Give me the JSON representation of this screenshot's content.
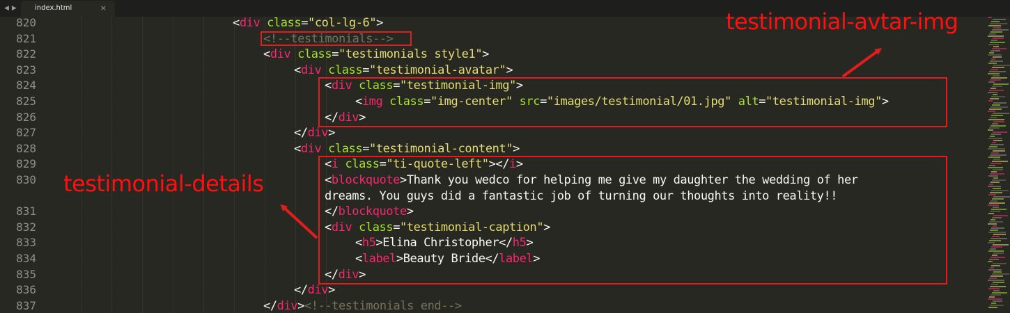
{
  "tab": {
    "title": "index.html",
    "close_glyph": "×"
  },
  "nav_arrows": [
    "◀",
    "▶"
  ],
  "line_numbers": [
    "820",
    "821",
    "822",
    "823",
    "824",
    "825",
    "826",
    "827",
    "828",
    "829",
    "830",
    "",
    "831",
    "832",
    "833",
    "834",
    "835",
    "836",
    "837"
  ],
  "code": {
    "l820": [
      "<",
      "div",
      " ",
      "class",
      "=",
      "\"col-lg-6\"",
      ">"
    ],
    "l821": "<!--testimonials-->",
    "l822": [
      "<",
      "div",
      " ",
      "class",
      "=",
      "\"testimonials style1\"",
      ">"
    ],
    "l823": [
      "<",
      "div",
      " ",
      "class",
      "=",
      "\"testimonial-avatar\"",
      ">"
    ],
    "l824": [
      "<",
      "div",
      " ",
      "class",
      "=",
      "\"testimonial-img\"",
      ">"
    ],
    "l825": [
      "<",
      "img",
      " ",
      "class",
      "=",
      "\"img-center\"",
      " ",
      "src",
      "=",
      "\"images/testimonial/01.jpg\"",
      " ",
      "alt",
      "=",
      "\"testimonial-img\"",
      ">"
    ],
    "l826": [
      "</",
      "div",
      ">"
    ],
    "l827": [
      "</",
      "div",
      ">"
    ],
    "l828": [
      "<",
      "div",
      " ",
      "class",
      "=",
      "\"testimonial-content\"",
      ">"
    ],
    "l829": [
      "<",
      "i",
      " ",
      "class",
      "=",
      "\"ti-quote-left\"",
      "></",
      "i",
      ">"
    ],
    "l830a": [
      "<",
      "blockquote",
      ">",
      "Thank you wedco for helping me give my daughter the wedding of her"
    ],
    "l830b": "dreams. You guys did a fantastic job of turning our thoughts into reality!!",
    "l831": [
      "</",
      "blockquote",
      ">"
    ],
    "l832": [
      "<",
      "div",
      " ",
      "class",
      "=",
      "\"testimonial-caption\"",
      ">"
    ],
    "l833": [
      "<",
      "h5",
      ">",
      "Elina Christopher",
      "</",
      "h5",
      ">"
    ],
    "l834": [
      "<",
      "label",
      ">",
      "Beauty Bride",
      "</",
      "label",
      ">"
    ],
    "l835": [
      "</",
      "div",
      ">"
    ],
    "l836": [
      "</",
      "div",
      ">"
    ],
    "l837": [
      "</",
      "div",
      ">",
      "<!--testimonials end-->"
    ]
  },
  "annotations": {
    "avatar_label": "testimonial-avtar-img",
    "details_label": "testimonial-details"
  },
  "colors": {
    "background": "#272822",
    "tag": "#f92672",
    "attribute": "#a6e22e",
    "string": "#e6db74",
    "comment": "#75715e",
    "annotation": "#ff1010"
  }
}
